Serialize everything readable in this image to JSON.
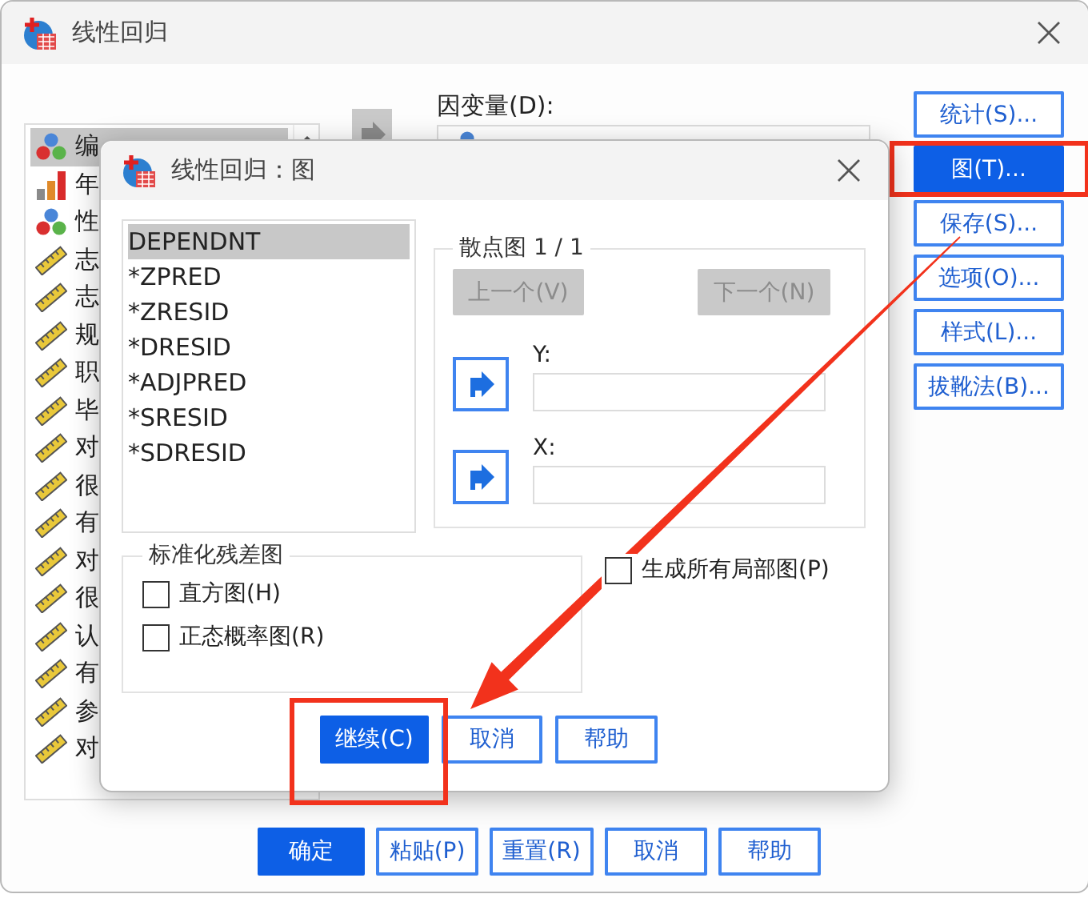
{
  "main_window": {
    "title": "线性回归",
    "variables": [
      {
        "text": "编",
        "kind": "nominal",
        "selected": true
      },
      {
        "text": "年",
        "kind": "ordinal",
        "selected": false
      },
      {
        "text": "性",
        "kind": "nominal",
        "selected": false
      },
      {
        "text": "志",
        "kind": "scale",
        "selected": false
      },
      {
        "text": "志",
        "kind": "scale",
        "selected": false
      },
      {
        "text": "规",
        "kind": "scale",
        "selected": false
      },
      {
        "text": "职",
        "kind": "scale",
        "selected": false
      },
      {
        "text": "毕",
        "kind": "scale",
        "selected": false
      },
      {
        "text": "对",
        "kind": "scale",
        "selected": false
      },
      {
        "text": "很",
        "kind": "scale",
        "selected": false
      },
      {
        "text": "有",
        "kind": "scale",
        "selected": false
      },
      {
        "text": "对",
        "kind": "scale",
        "selected": false
      },
      {
        "text": "很",
        "kind": "scale",
        "selected": false
      },
      {
        "text": "认",
        "kind": "scale",
        "selected": false
      },
      {
        "text": "有",
        "kind": "scale",
        "selected": false
      },
      {
        "text": "参",
        "kind": "scale",
        "selected": false
      },
      {
        "text": "对",
        "kind": "scale",
        "selected": false
      }
    ],
    "dependent": {
      "label": "因变量(D):"
    },
    "side_buttons": [
      {
        "label": "统计(S)...",
        "selected": false,
        "highlighted": false
      },
      {
        "label": "图(T)...",
        "selected": true,
        "highlighted": true
      },
      {
        "label": "保存(S)...",
        "selected": false,
        "highlighted": false
      },
      {
        "label": "选项(O)...",
        "selected": false,
        "highlighted": false
      },
      {
        "label": "样式(L)...",
        "selected": false,
        "highlighted": false
      },
      {
        "label": "拔靴法(B)...",
        "selected": false,
        "highlighted": false
      }
    ],
    "bottom_buttons": [
      {
        "label": "确定",
        "primary": true
      },
      {
        "label": "粘贴(P)",
        "primary": false
      },
      {
        "label": "重置(R)",
        "primary": false
      },
      {
        "label": "取消",
        "primary": false
      },
      {
        "label": "帮助",
        "primary": false
      }
    ]
  },
  "plot_dialog": {
    "title": "线性回归：图",
    "variables": [
      {
        "text": "DEPENDNT",
        "selected": true
      },
      {
        "text": "*ZPRED",
        "selected": false
      },
      {
        "text": "*ZRESID",
        "selected": false
      },
      {
        "text": "*DRESID",
        "selected": false
      },
      {
        "text": "*ADJPRED",
        "selected": false
      },
      {
        "text": "*SRESID",
        "selected": false
      },
      {
        "text": "*SDRESID",
        "selected": false
      }
    ],
    "scatter": {
      "legend": "散点图 1 / 1",
      "previous": {
        "label": "上一个(V)",
        "disabled": true
      },
      "next": {
        "label": "下一个(N)",
        "disabled": true
      },
      "axes": [
        {
          "label": "Y:"
        },
        {
          "label": "X:"
        }
      ]
    },
    "residual_group": {
      "legend": "标准化残差图",
      "options": [
        {
          "label": "直方图(H)",
          "checked": false
        },
        {
          "label": "正态概率图(R)",
          "checked": false
        }
      ]
    },
    "partial_plots": {
      "label": "生成所有局部图(P)",
      "checked": false
    },
    "buttons": [
      {
        "label": "继续(C)",
        "primary": true,
        "highlighted": true
      },
      {
        "label": "取消",
        "primary": false,
        "highlighted": false
      },
      {
        "label": "帮助",
        "primary": false,
        "highlighted": false
      }
    ]
  }
}
